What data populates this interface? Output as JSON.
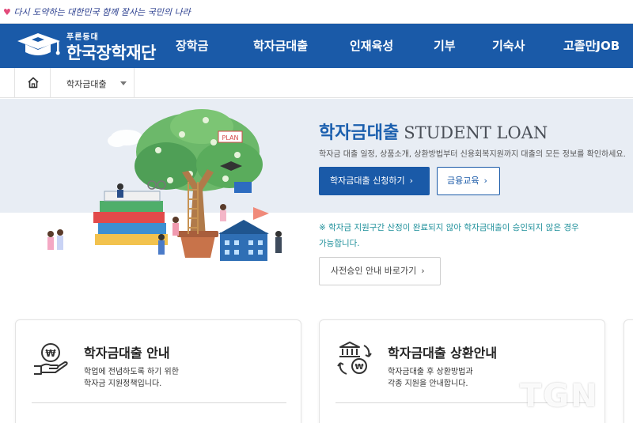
{
  "slogan": {
    "text": "다시 도약하는 대한민국 함께 잘사는 국민의 나라",
    "color": "#2b3f8f"
  },
  "header": {
    "logo_small": "푸른등대",
    "logo_name": "한국장학재단",
    "bg_color": "#1a5aa8",
    "nav": [
      "장학금",
      "학자금대출",
      "인재육성",
      "기부",
      "기숙사",
      "고졸만JOB"
    ]
  },
  "breadcrumb": {
    "home_icon": "home-icon",
    "current": "학자금대출"
  },
  "hero": {
    "title_ko": "학자금대출",
    "title_en": "STUDENT LOAN",
    "description": "학자금 대출 일정, 상품소개, 상환방법부터 신용회복지원까지 대출의 모든 정보를 확인하세요.",
    "apply_button": "학자금대출 신청하기",
    "edu_button": "금융교육",
    "notice_line1": "※ 학자금 지원구간 산정이 완료되지 않아 학자금대출이 승인되지 않은 경우",
    "notice_line2": "가능합니다.",
    "preapprove_button": "사전승인 안내 바로가기",
    "accent_color": "#1b5fae",
    "notice_color": "#1d8f9a",
    "art_label": "PLAN"
  },
  "cards": [
    {
      "icon": "hand-won-coin-icon",
      "title": "학자금대출 안내",
      "desc_line1": "학업에 전념하도록 하기 위한",
      "desc_line2": "학자금 지원정책입니다."
    },
    {
      "icon": "bank-won-cycle-icon",
      "title": "학자금대출 상환안내",
      "desc_line1": "학자금대출 후 상환방법과",
      "desc_line2": "각종 지원을 안내합니다."
    }
  ],
  "watermark": "TGN"
}
